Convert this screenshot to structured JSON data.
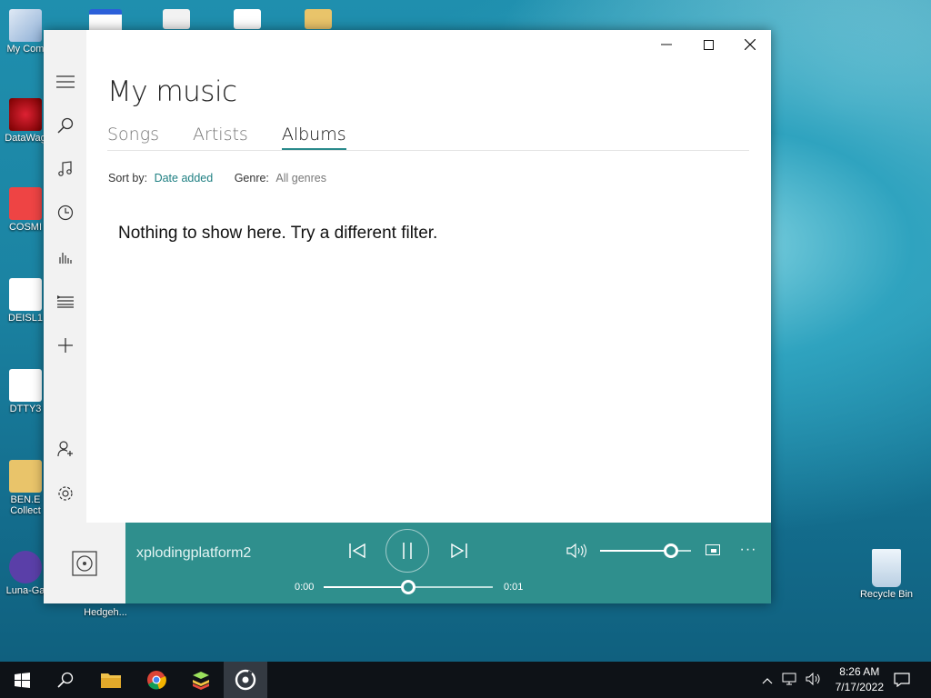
{
  "desktop": {
    "icons": [
      {
        "label": "My Com"
      },
      {
        "label": "DataWag"
      },
      {
        "label": "COSMI"
      },
      {
        "label": "DEISL1"
      },
      {
        "label": "DTTY3"
      },
      {
        "label": "BEN.E\nCollect"
      },
      {
        "label": "Luna-Ga"
      },
      {
        "label": "Hedgeh..."
      },
      {
        "label": "Recycle Bin"
      }
    ]
  },
  "window": {
    "controls": {
      "minimize": "—",
      "maximize": "☐",
      "close": "✕"
    },
    "title": "My music",
    "tabs": [
      {
        "label": "Songs"
      },
      {
        "label": "Artists"
      },
      {
        "label": "Albums",
        "active": true
      }
    ],
    "filters": {
      "sort_label": "Sort by:",
      "sort_value": "Date added",
      "genre_label": "Genre:",
      "genre_value": "All genres"
    },
    "empty_message": "Nothing to show here. Try a different filter."
  },
  "player": {
    "track_name": "xplodingplatform2",
    "time_elapsed": "0:00",
    "time_total": "0:01",
    "progress_fraction": 0.5,
    "volume_fraction": 0.78,
    "accent_color": "#2f8f8d"
  },
  "taskbar": {
    "clock_time": "8:26 AM",
    "clock_date": "7/17/2022"
  }
}
